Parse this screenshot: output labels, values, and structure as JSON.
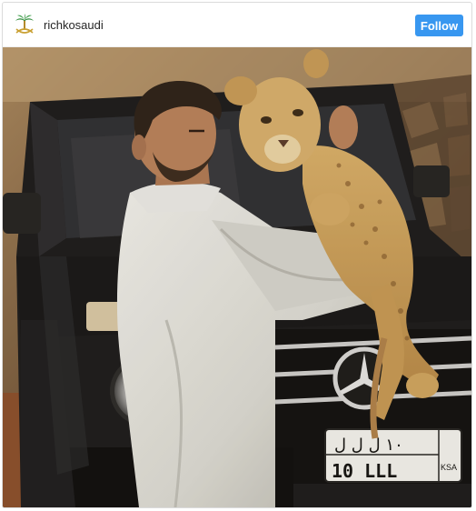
{
  "post": {
    "username": "richkosaudi",
    "follow_label": "Follow",
    "avatar_icon": "palm-swords-emblem-icon",
    "photo_subject": "photo",
    "plate": {
      "arabic_top": "١٠ ل ل ل",
      "latin_bottom": "10 LLL",
      "country_code": "KSA"
    }
  },
  "colors": {
    "follow_button": "#3897f0",
    "username_text": "#262626",
    "card_border": "#dbdbdb"
  }
}
